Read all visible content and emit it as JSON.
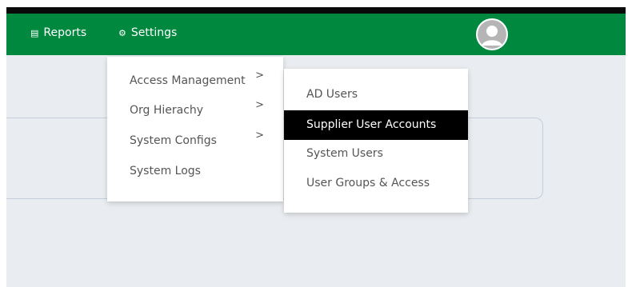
{
  "nav": {
    "reports_label": "Reports",
    "reports_icon": "list-icon",
    "settings_label": "Settings",
    "settings_icon": "gears-icon",
    "brand_color": "#00883f"
  },
  "settings_menu": {
    "items": [
      {
        "label": "Access Management",
        "has_submenu": true
      },
      {
        "label": "Org Hierachy",
        "has_submenu": true
      },
      {
        "label": "System Configs",
        "has_submenu": true
      },
      {
        "label": "System Logs",
        "has_submenu": false
      }
    ],
    "chevron": ">"
  },
  "access_submenu": {
    "items": [
      {
        "label": "AD Users",
        "active": false
      },
      {
        "label": "Supplier User Accounts",
        "active": true
      },
      {
        "label": "System Users",
        "active": false
      },
      {
        "label": "User Groups & Access",
        "active": false
      }
    ]
  }
}
